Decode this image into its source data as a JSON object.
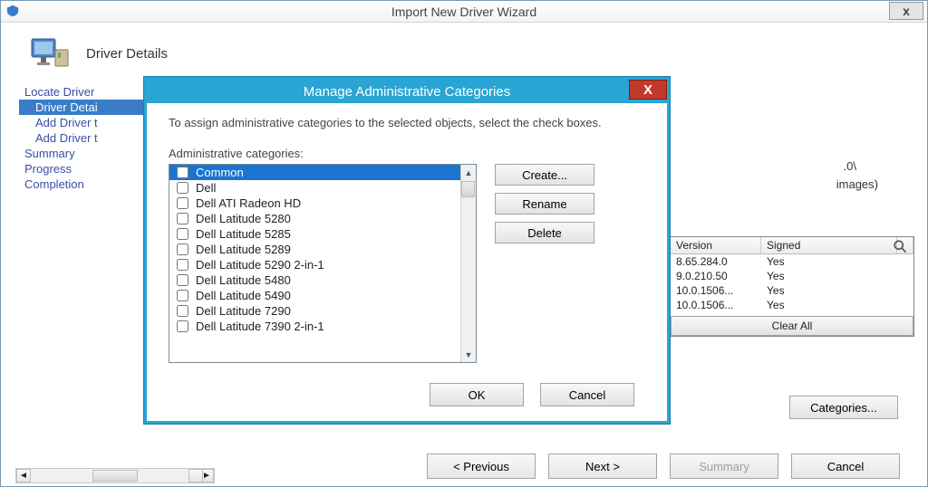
{
  "window": {
    "title": "Import New Driver Wizard",
    "close_x": "x"
  },
  "header": {
    "title": "Driver Details"
  },
  "sidebar": {
    "items": [
      {
        "label": "Locate Driver",
        "indent": false,
        "active": false
      },
      {
        "label": "Driver Detai",
        "indent": true,
        "active": true
      },
      {
        "label": "Add Driver t",
        "indent": true,
        "active": false
      },
      {
        "label": "Add Driver t",
        "indent": true,
        "active": false
      },
      {
        "label": "Summary",
        "indent": false,
        "active": false
      },
      {
        "label": "Progress",
        "indent": false,
        "active": false
      },
      {
        "label": "Completion",
        "indent": false,
        "active": false
      }
    ]
  },
  "modal": {
    "title": "Manage Administrative Categories",
    "close_x": "X",
    "instruction": "To assign administrative categories to the selected objects, select the check boxes.",
    "list_label": "Administrative categories:",
    "categories": [
      "Common",
      "Dell",
      "Dell ATI Radeon HD",
      "Dell Latitude 5280",
      "Dell Latitude 5285",
      "Dell Latitude 5289",
      "Dell Latitude 5290 2-in-1",
      "Dell Latitude 5480",
      "Dell Latitude 5490",
      "Dell Latitude 7290",
      "Dell Latitude 7390 2-in-1"
    ],
    "selected_index": 0,
    "buttons": {
      "create": "Create...",
      "rename": "Rename",
      "delete": "Delete",
      "ok": "OK",
      "cancel": "Cancel"
    }
  },
  "right": {
    "path_tail": ".0\\",
    "images_tail": "images)",
    "table": {
      "headers": {
        "version": "Version",
        "signed": "Signed"
      },
      "rows": [
        {
          "version": "8.65.284.0",
          "signed": "Yes"
        },
        {
          "version": "9.0.210.50",
          "signed": "Yes"
        },
        {
          "version": "10.0.1506...",
          "signed": "Yes"
        },
        {
          "version": "10.0.1506...",
          "signed": "Yes"
        }
      ],
      "clear_all": "Clear All"
    },
    "categories_button": "Categories..."
  },
  "wizard_buttons": {
    "previous": "< Previous",
    "next": "Next >",
    "summary": "Summary",
    "cancel": "Cancel"
  }
}
